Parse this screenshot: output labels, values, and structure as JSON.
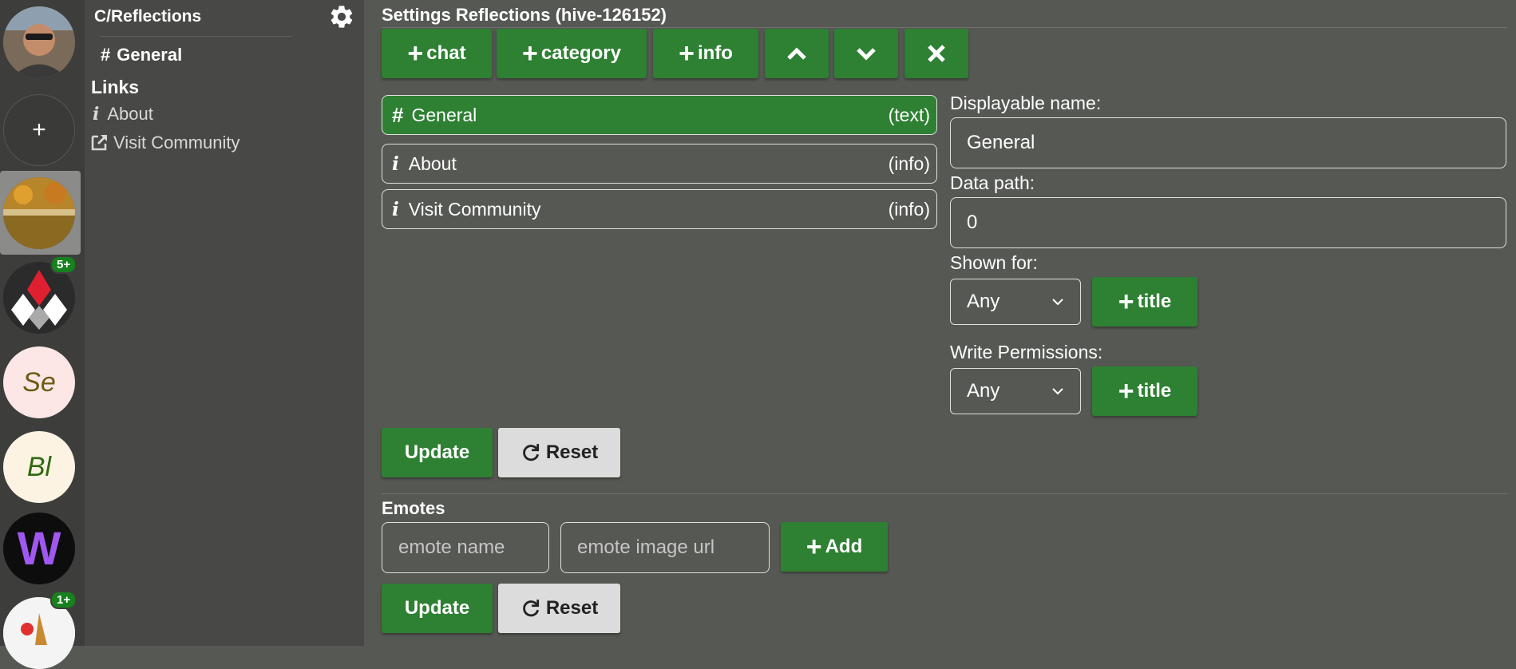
{
  "sidebar": {
    "servers": [
      {
        "id": "avatar",
        "label": ""
      },
      {
        "id": "add",
        "label": "+"
      },
      {
        "id": "reflections",
        "label": ""
      },
      {
        "id": "peak",
        "label": "",
        "badge": "5+"
      },
      {
        "id": "se",
        "label": "Se"
      },
      {
        "id": "bl",
        "label": "Bl"
      },
      {
        "id": "w",
        "label": "W"
      },
      {
        "id": "last",
        "label": "",
        "badge": "1+"
      }
    ]
  },
  "panel": {
    "title": "C/Reflections",
    "channels": [
      {
        "label": "General"
      }
    ],
    "links_title": "Links",
    "links": [
      {
        "label": "About"
      },
      {
        "label": "Visit Community"
      }
    ]
  },
  "main": {
    "title": "Settings Reflections (hive-126152)",
    "toolbar": {
      "chat": "chat",
      "category": "category",
      "info": "info"
    },
    "channel_list": [
      {
        "name": "General",
        "type": "(text)"
      },
      {
        "name": "About",
        "type": "(info)"
      },
      {
        "name": "Visit Community",
        "type": "(info)"
      }
    ],
    "form": {
      "displayable_label": "Displayable name:",
      "displayable_value": "General",
      "data_path_label": "Data path:",
      "data_path_value": "0",
      "shown_for_label": "Shown for:",
      "shown_for_value": "Any",
      "write_perm_label": "Write Permissions:",
      "write_perm_value": "Any",
      "title_btn": "title"
    },
    "update": "Update",
    "reset": "Reset",
    "emotes": {
      "title": "Emotes",
      "name_placeholder": "emote name",
      "url_placeholder": "emote image url",
      "add": "Add"
    }
  },
  "colors": {
    "accent": "#2e8033",
    "background": "#565853",
    "rail": "#3d3e3b",
    "panel": "#484946"
  }
}
